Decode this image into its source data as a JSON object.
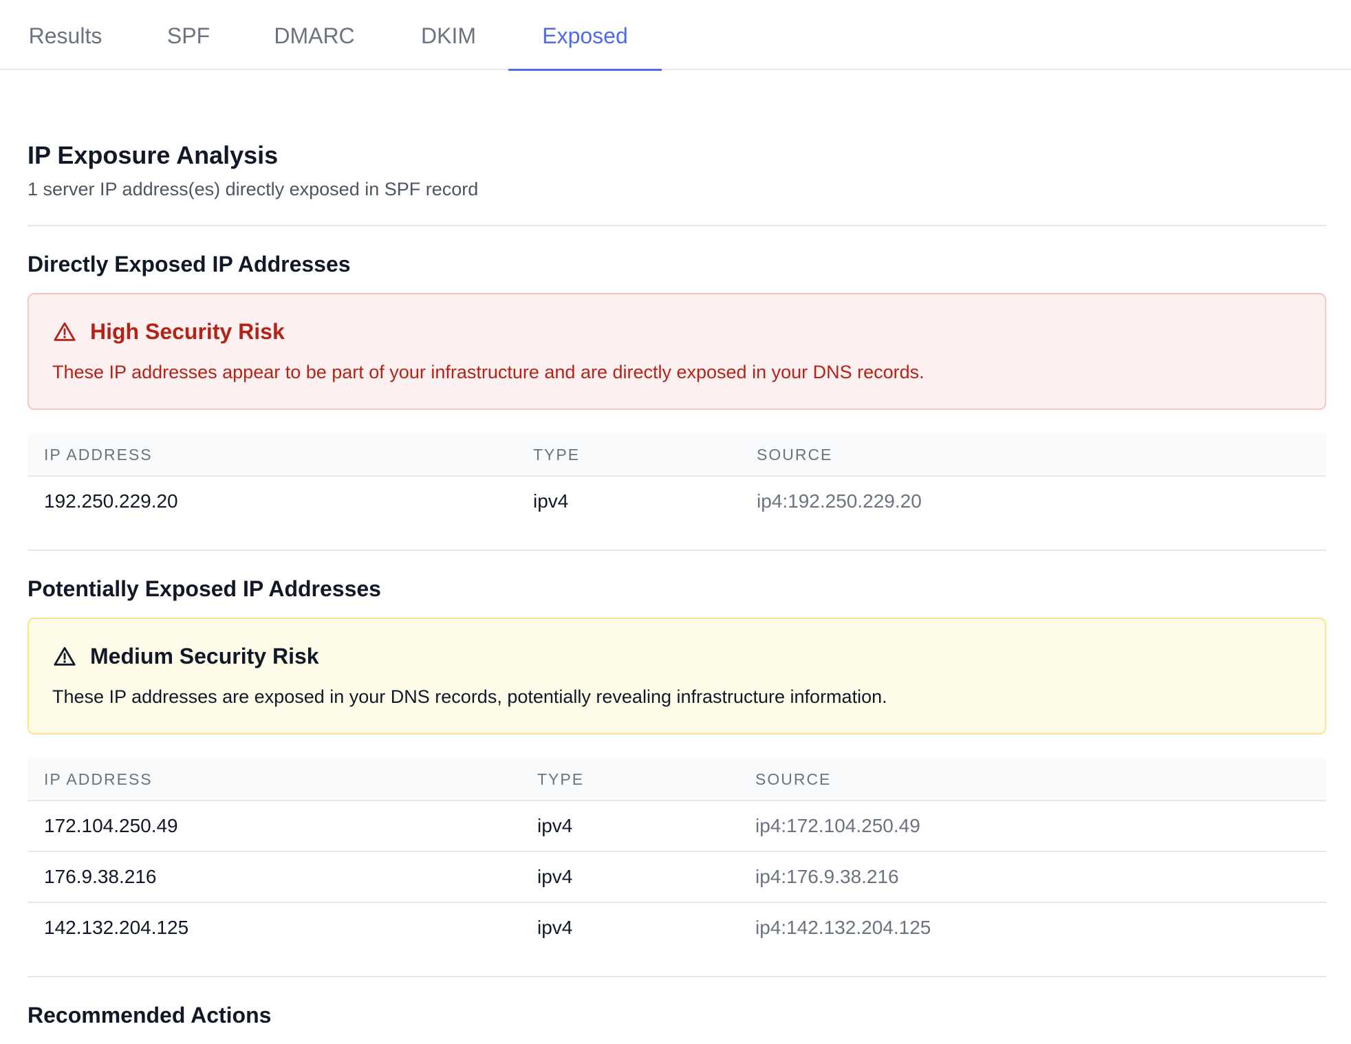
{
  "tabs": [
    {
      "label": "Results"
    },
    {
      "label": "SPF"
    },
    {
      "label": "DMARC"
    },
    {
      "label": "DKIM"
    },
    {
      "label": "Exposed"
    }
  ],
  "active_tab": "Exposed",
  "page": {
    "title": "IP Exposure Analysis",
    "subtitle": "1 server IP address(es) directly exposed in SPF record"
  },
  "direct": {
    "title": "Directly Exposed IP Addresses",
    "alert": {
      "title": "High Security Risk",
      "text": "These IP addresses appear to be part of your infrastructure and are directly exposed in your DNS records.",
      "color": "#b42318",
      "icon": "warning-triangle-icon"
    },
    "headers": [
      "IP ADDRESS",
      "TYPE",
      "SOURCE"
    ],
    "rows": [
      {
        "ip": "192.250.229.20",
        "type": "ipv4",
        "source": "ip4:192.250.229.20"
      }
    ]
  },
  "potential": {
    "title": "Potentially Exposed IP Addresses",
    "alert": {
      "title": "Medium Security Risk",
      "text": "These IP addresses are exposed in your DNS records, potentially revealing infrastructure information.",
      "color": "#111827",
      "icon": "warning-triangle-icon"
    },
    "headers": [
      "IP ADDRESS",
      "TYPE",
      "SOURCE"
    ],
    "rows": [
      {
        "ip": "172.104.250.49",
        "type": "ipv4",
        "source": "ip4:172.104.250.49"
      },
      {
        "ip": "176.9.38.216",
        "type": "ipv4",
        "source": "ip4:176.9.38.216"
      },
      {
        "ip": "142.132.204.125",
        "type": "ipv4",
        "source": "ip4:142.132.204.125"
      }
    ]
  },
  "recommended": {
    "title": "Recommended Actions"
  },
  "colors": {
    "accent": "#4f6bed",
    "high_bg": "#fdf0f0",
    "high_border": "#f5c6c6",
    "medium_bg": "#fefce8",
    "medium_border": "#fbe38c"
  }
}
